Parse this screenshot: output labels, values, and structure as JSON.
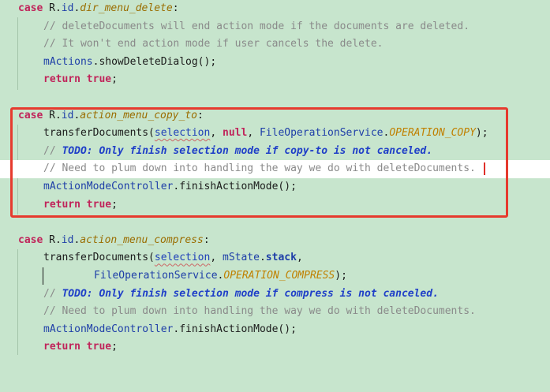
{
  "editor": {
    "highlight_color": "#e63a2e",
    "background_color": "#c7e5cd",
    "blocks": [
      {
        "lines": [
          {
            "kind": "case",
            "case": "case",
            "r": "R",
            "id": "id",
            "field": "dir_menu_delete",
            "colon": ":"
          },
          {
            "kind": "comment",
            "text": "// deleteDocuments will end action mode if the documents are deleted."
          },
          {
            "kind": "comment",
            "text": "// It won't end action mode if user cancels the delete."
          },
          {
            "kind": "call",
            "obj": "mActions",
            "dot": ".",
            "rest": "showDeleteDialog();"
          },
          {
            "kind": "return",
            "ret": "return",
            "val": "true",
            "semi": ";"
          }
        ]
      },
      {
        "lines": [
          {
            "kind": "case",
            "case": "case",
            "r": "R",
            "id": "id",
            "field": "action_menu_copy_to",
            "colon": ":"
          },
          {
            "kind": "transfer",
            "fn": "transferDocuments(",
            "arg1": "selection",
            "comma1": ", ",
            "nullkw": "null",
            "comma2": ", ",
            "cls": "FileOperationService",
            "dot": ".",
            "const": "OPERATION_COPY",
            "end": ");"
          },
          {
            "kind": "todo",
            "slash": "// ",
            "text": "TODO: Only finish selection mode if copy-to is not canceled."
          },
          {
            "kind": "comment",
            "text": "// Need to plum down into handling the way we do with deleteDocuments."
          },
          {
            "kind": "call",
            "obj": "mActionModeController",
            "dot": ".",
            "rest": "finishActionMode();"
          },
          {
            "kind": "return",
            "ret": "return",
            "val": "true",
            "semi": ";"
          }
        ]
      },
      {
        "lines": [
          {
            "kind": "case",
            "case": "case",
            "r": "R",
            "id": "id",
            "field": "action_menu_compress",
            "colon": ":"
          },
          {
            "kind": "transfer2a",
            "fn": "transferDocuments(",
            "arg1": "selection",
            "comma1": ", ",
            "obj": "mState",
            "dot": ".",
            "field": "stack",
            "comma2": ","
          },
          {
            "kind": "transfer2b",
            "cls": "FileOperationService",
            "dot": ".",
            "const": "OPERATION_COMPRESS",
            "end": ");"
          },
          {
            "kind": "todo",
            "slash": "// ",
            "text": "TODO: Only finish selection mode if compress is not canceled."
          },
          {
            "kind": "comment",
            "text": "// Need to plum down into handling the way we do with deleteDocuments."
          },
          {
            "kind": "call",
            "obj": "mActionModeController",
            "dot": ".",
            "rest": "finishActionMode();"
          },
          {
            "kind": "return",
            "ret": "return",
            "val": "true",
            "semi": ";"
          }
        ]
      }
    ]
  }
}
